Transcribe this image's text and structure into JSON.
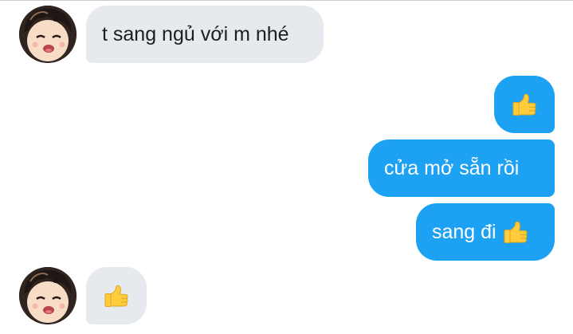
{
  "conversation": {
    "messages": [
      {
        "sender": "contact",
        "text": "t sang ngủ với m nhé"
      },
      {
        "sender": "me",
        "emoji": "thumbs-up"
      },
      {
        "sender": "me",
        "text": "cửa mở sẵn rồi"
      },
      {
        "sender": "me",
        "text": "sang đi",
        "emoji": "thumbs-up"
      },
      {
        "sender": "contact",
        "emoji": "thumbs-up"
      }
    ]
  },
  "colors": {
    "incoming_bubble": "#e6e9ed",
    "outgoing_bubble": "#1da1f2",
    "incoming_text": "#1c1e21",
    "outgoing_text": "#ffffff",
    "emoji_yellow": "#ffcc3b"
  }
}
